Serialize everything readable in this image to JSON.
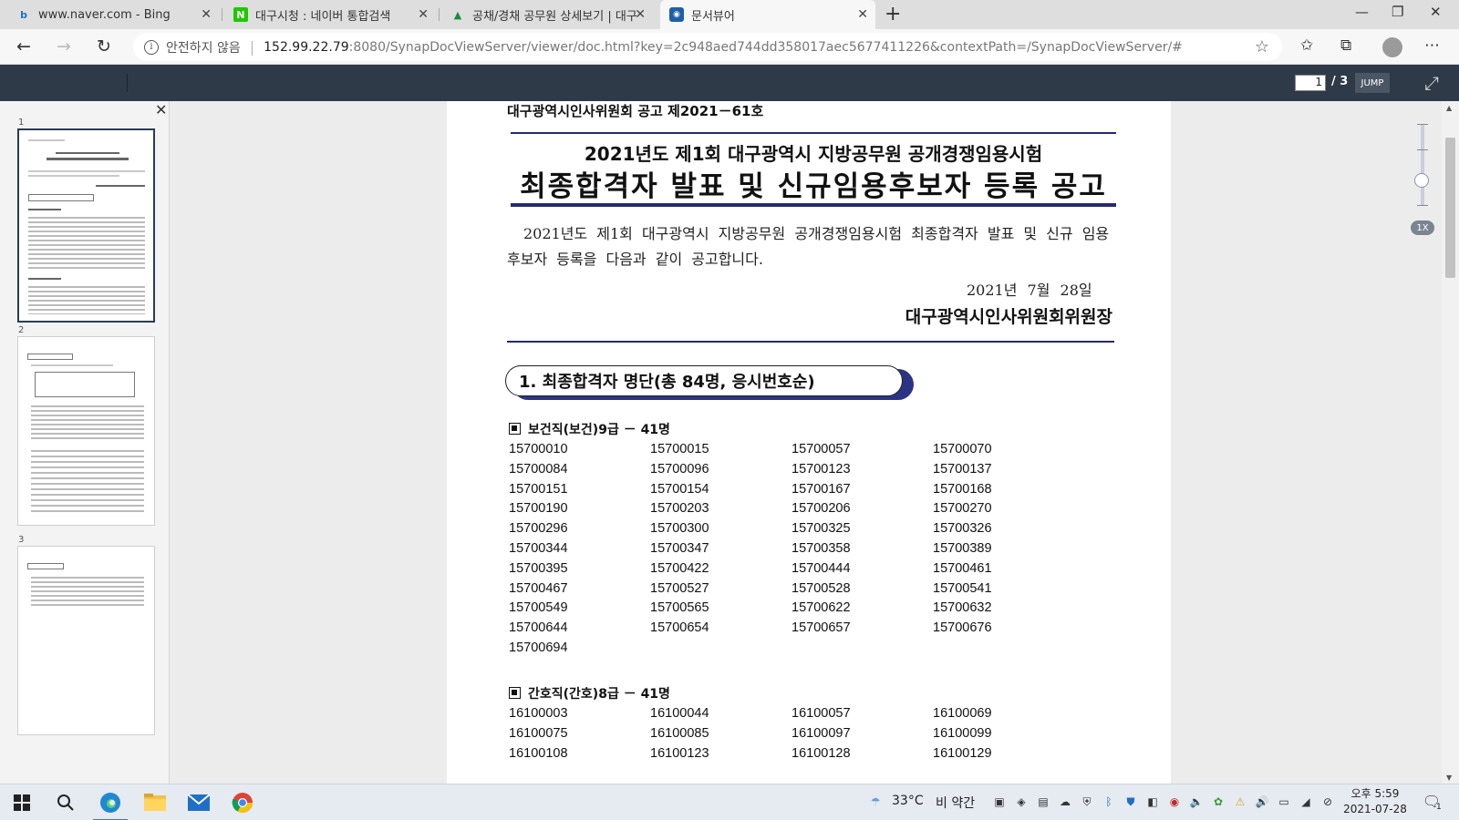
{
  "tabs": [
    {
      "label": "www.naver.com - Bing",
      "icon": "bing-icon"
    },
    {
      "label": "대구시청 : 네이버 통합검색",
      "icon": "naver-icon"
    },
    {
      "label": "공채/경채 공무원 상세보기 | 대구",
      "icon": "gongdangi-icon"
    },
    {
      "label": "문서뷰어",
      "icon": "viewer-icon"
    }
  ],
  "address": {
    "security_label": "안전하지 않음",
    "host": "152.99.22.79",
    "path": ":8080/SynapDocViewServer/viewer/doc.html?key=2c948aed744dd358017aec5677411226&contextPath=/SynapDocViewServer/#"
  },
  "viewer": {
    "page_current": "1",
    "page_total": "/ 3",
    "jump_label": "JUMP",
    "zoom_label": "1X",
    "thumb_numbers": [
      "1",
      "2",
      "3"
    ]
  },
  "document": {
    "notice_number": "대구광역시인사위원회 공고 제2021－61호",
    "title_sub": "2021년도 제1회 대구광역시 지방공무원 공개경쟁임용시험",
    "title_main": "최종합격자 발표 및 신규임용후보자 등록 공고",
    "intro": "2021년도 제1회 대구광역시 지방공무원 공개경쟁임용시험 최종합격자 발표 및 신규 임용후보자 등록을 다음과 같이 공고합니다.",
    "date": "2021년 7월 28일",
    "signer": "대구광역시인사위원회위원장",
    "section1_title": "1. 최종합격자 명단(총 84명, 응시번호순)",
    "categories": [
      {
        "title": "보건직(보건)9급 － 41명",
        "rows": [
          [
            "15700010",
            "15700015",
            "15700057",
            "15700070"
          ],
          [
            "15700084",
            "15700096",
            "15700123",
            "15700137"
          ],
          [
            "15700151",
            "15700154",
            "15700167",
            "15700168"
          ],
          [
            "15700190",
            "15700203",
            "15700206",
            "15700270"
          ],
          [
            "15700296",
            "15700300",
            "15700325",
            "15700326"
          ],
          [
            "15700344",
            "15700347",
            "15700358",
            "15700389"
          ],
          [
            "15700395",
            "15700422",
            "15700444",
            "15700461"
          ],
          [
            "15700467",
            "15700527",
            "15700528",
            "15700541"
          ],
          [
            "15700549",
            "15700565",
            "15700622",
            "15700632"
          ],
          [
            "15700644",
            "15700654",
            "15700657",
            "15700676"
          ],
          [
            "15700694"
          ]
        ]
      },
      {
        "title": "간호직(간호)8급 － 41명",
        "rows": [
          [
            "16100003",
            "16100044",
            "16100057",
            "16100069"
          ],
          [
            "16100075",
            "16100085",
            "16100097",
            "16100099"
          ],
          [
            "16100108",
            "16100123",
            "16100128",
            "16100129"
          ]
        ]
      }
    ]
  },
  "taskbar": {
    "weather_temp": "33°C",
    "weather_desc": "비 약간",
    "time": "오후 5:59",
    "date": "2021-07-28",
    "notification_count": "1"
  }
}
